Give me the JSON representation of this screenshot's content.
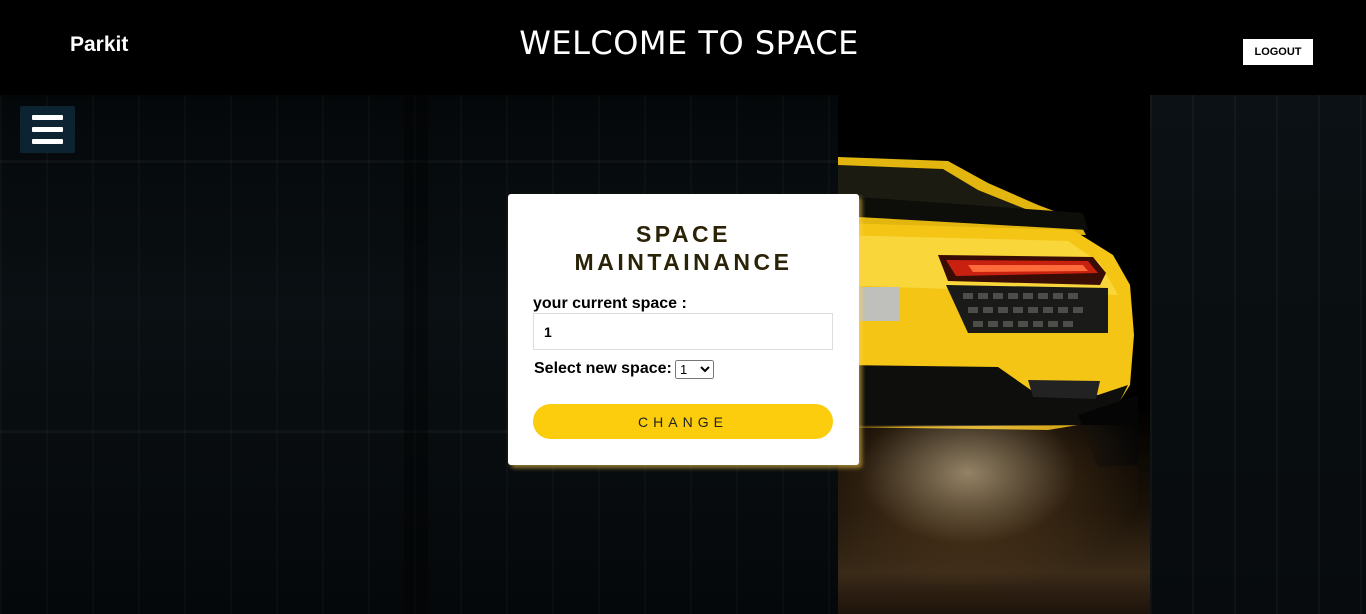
{
  "header": {
    "brand": "Parkit",
    "title": "WELCOME TO SPACE",
    "logout_label": "LOGOUT"
  },
  "form": {
    "title_line1": "SPACE",
    "title_line2": "MAINTAINANCE",
    "current_space_label": "your current space :",
    "current_space_value": "1",
    "new_space_label": "Select new space:",
    "new_space_selected": "1",
    "change_label": "CHANGE"
  },
  "colors": {
    "accent": "#fccd0c",
    "menu_button": "#0c2332",
    "car_body": "#f5c516"
  },
  "icons": {
    "menu": "hamburger-icon"
  }
}
